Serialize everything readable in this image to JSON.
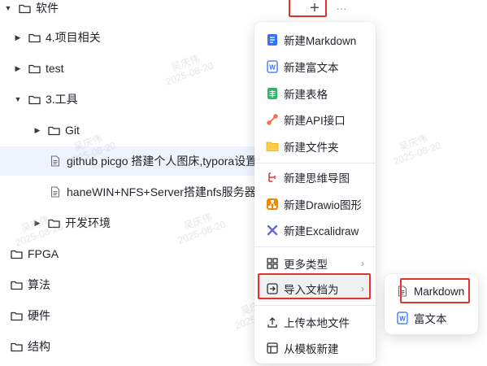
{
  "tree": {
    "items": [
      {
        "label": "软件",
        "expanded": true
      },
      {
        "label": "4.项目相关",
        "expanded": false
      },
      {
        "label": "test",
        "expanded": false
      },
      {
        "label": "3.工具",
        "expanded": true
      },
      {
        "label": "Git",
        "expanded": false
      },
      {
        "label": "github picgo 搭建个人图床,typora设置",
        "type": "doc",
        "selected": true
      },
      {
        "label": "haneWIN+NFS+Server搭建nfs服务器,",
        "type": "doc"
      },
      {
        "label": "开发环境",
        "expanded": false
      },
      {
        "label": "FPGA"
      },
      {
        "label": "算法"
      },
      {
        "label": "硬件"
      },
      {
        "label": "结构"
      }
    ]
  },
  "toolbar": {
    "add_symbol": "+",
    "more_symbol": "···"
  },
  "watermark": {
    "name": "吴庆伟",
    "date": "2025-08-20"
  },
  "menu": {
    "items": [
      {
        "label": "新建Markdown",
        "icon": "markdown-doc-icon"
      },
      {
        "label": "新建富文本",
        "icon": "word-doc-icon"
      },
      {
        "label": "新建表格",
        "icon": "sheet-icon"
      },
      {
        "label": "新建API接口",
        "icon": "api-icon"
      },
      {
        "label": "新建文件夹",
        "icon": "folder-icon"
      },
      {
        "label": "新建思维导图",
        "icon": "mindmap-icon"
      },
      {
        "label": "新建Drawio图形",
        "icon": "drawio-icon"
      },
      {
        "label": "新建Excalidraw",
        "icon": "excalidraw-icon"
      },
      {
        "label": "更多类型",
        "icon": "grid-icon",
        "has_submenu": true
      },
      {
        "label": "导入文档为",
        "icon": "import-icon",
        "has_submenu": true,
        "highlighted": true
      },
      {
        "label": "上传本地文件",
        "icon": "upload-icon"
      },
      {
        "label": "从模板新建",
        "icon": "template-icon"
      }
    ]
  },
  "submenu": {
    "items": [
      {
        "label": "Markdown",
        "icon": "markdown-doc-icon"
      },
      {
        "label": "富文本",
        "icon": "word-doc-icon"
      }
    ]
  },
  "colors": {
    "highlight_border": "#e0342c",
    "selected_row": "#eef3fd",
    "hover_item": "#eff0f1"
  }
}
